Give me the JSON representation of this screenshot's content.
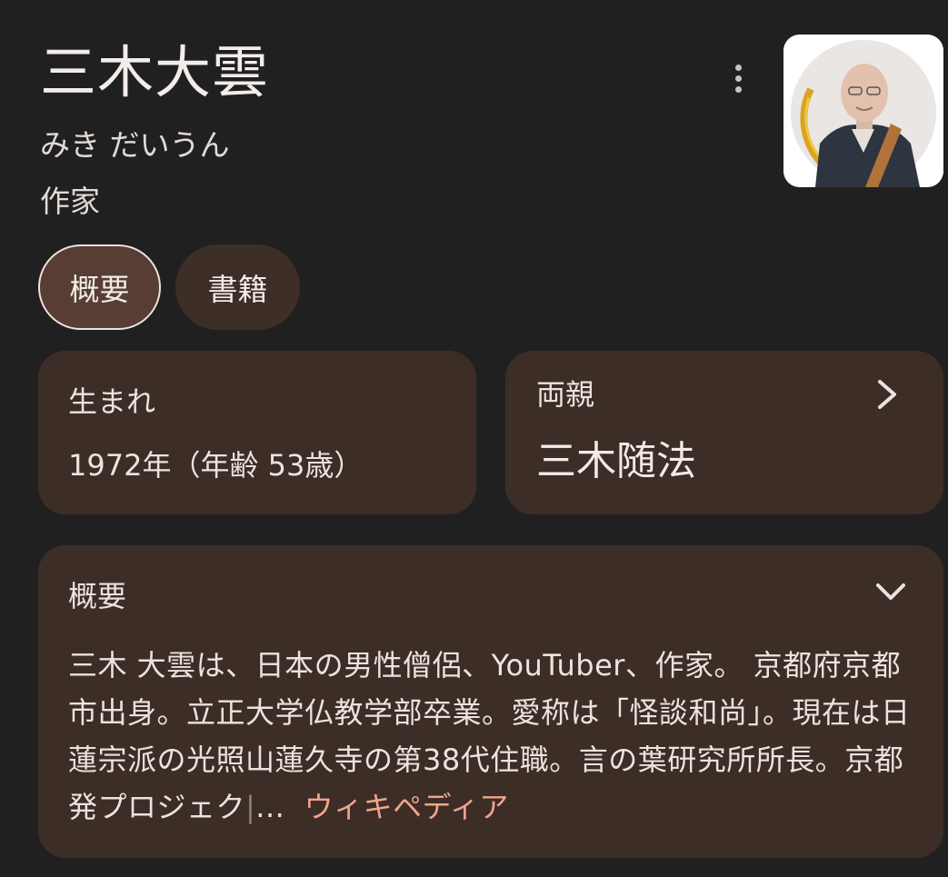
{
  "entity": {
    "name": "三木大雲",
    "reading": "みき だいうん",
    "occupation": "作家"
  },
  "tabs": [
    {
      "label": "概要",
      "selected": true
    },
    {
      "label": "書籍",
      "selected": false
    }
  ],
  "facts": {
    "born": {
      "label": "生まれ",
      "value": "1972年（年齢 53歳）"
    },
    "parents": {
      "label": "両親",
      "value": "三木随法"
    }
  },
  "summary": {
    "label": "概要",
    "text": "三木 大雲は、日本の男性僧侶、YouTuber、作家。 京都府京都市出身。立正大学仏教学部卒業。愛称は「怪談和尚」。現在は日蓮宗派の光照山蓮久寺の第38代住職。言の葉研究所所長。京都発プロジェク",
    "ellipsis": "...",
    "source_link": "ウィキペディア"
  },
  "icons": {
    "more": "more-vert-icon",
    "parents_chevron": "chevron-right-icon",
    "summary_chevron": "chevron-down-icon"
  },
  "colors": {
    "background": "#202020",
    "card": "#3d2d27",
    "chip_selected": "#573d33",
    "link": "#f2a48d"
  }
}
